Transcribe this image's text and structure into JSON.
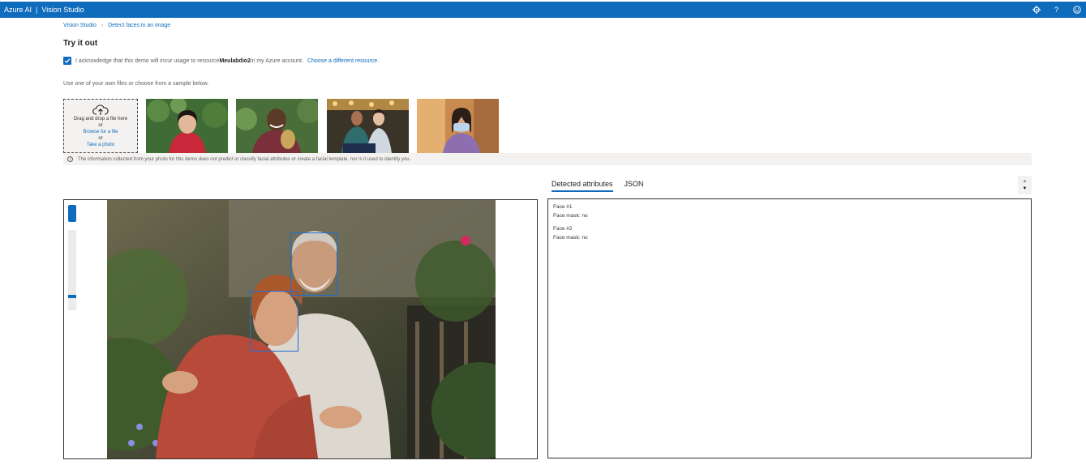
{
  "topbar": {
    "brand": "Azure AI",
    "product": "Vision Studio",
    "icons": [
      "settings-icon",
      "help-icon",
      "feedback-icon"
    ]
  },
  "breadcrumb": {
    "home": "Vision Studio",
    "current": "Detect faces in an image"
  },
  "page_title": "Try it out",
  "acknowledge": {
    "checked": true,
    "text_before": "I acknowledge that this demo will incur usage to resource ",
    "resource": "Meulabdio2",
    "text_after": " in my Azure account.",
    "link": "Choose a different resource."
  },
  "instructions": "Use one of your own files or choose from a sample below.",
  "upload": {
    "line1": "Drag and drop a file here",
    "or1": "or",
    "browse": "Browse for a file",
    "or2": "or",
    "photo": "Take a photo"
  },
  "info_note": "The information collected from your photo for this demo does not predict or classify facial attributes or create a facial template, nor is it used to identify you.",
  "tabs": [
    {
      "label": "Detected attributes",
      "active": true
    },
    {
      "label": "JSON",
      "active": false
    }
  ],
  "results": [
    {
      "title": "Face #1",
      "attr": "Face mask: no"
    },
    {
      "title": "Face #2",
      "attr": "Face mask: no"
    }
  ],
  "colors": {
    "accent": "#0f6cbd",
    "face_box": "#1f6fd6"
  }
}
